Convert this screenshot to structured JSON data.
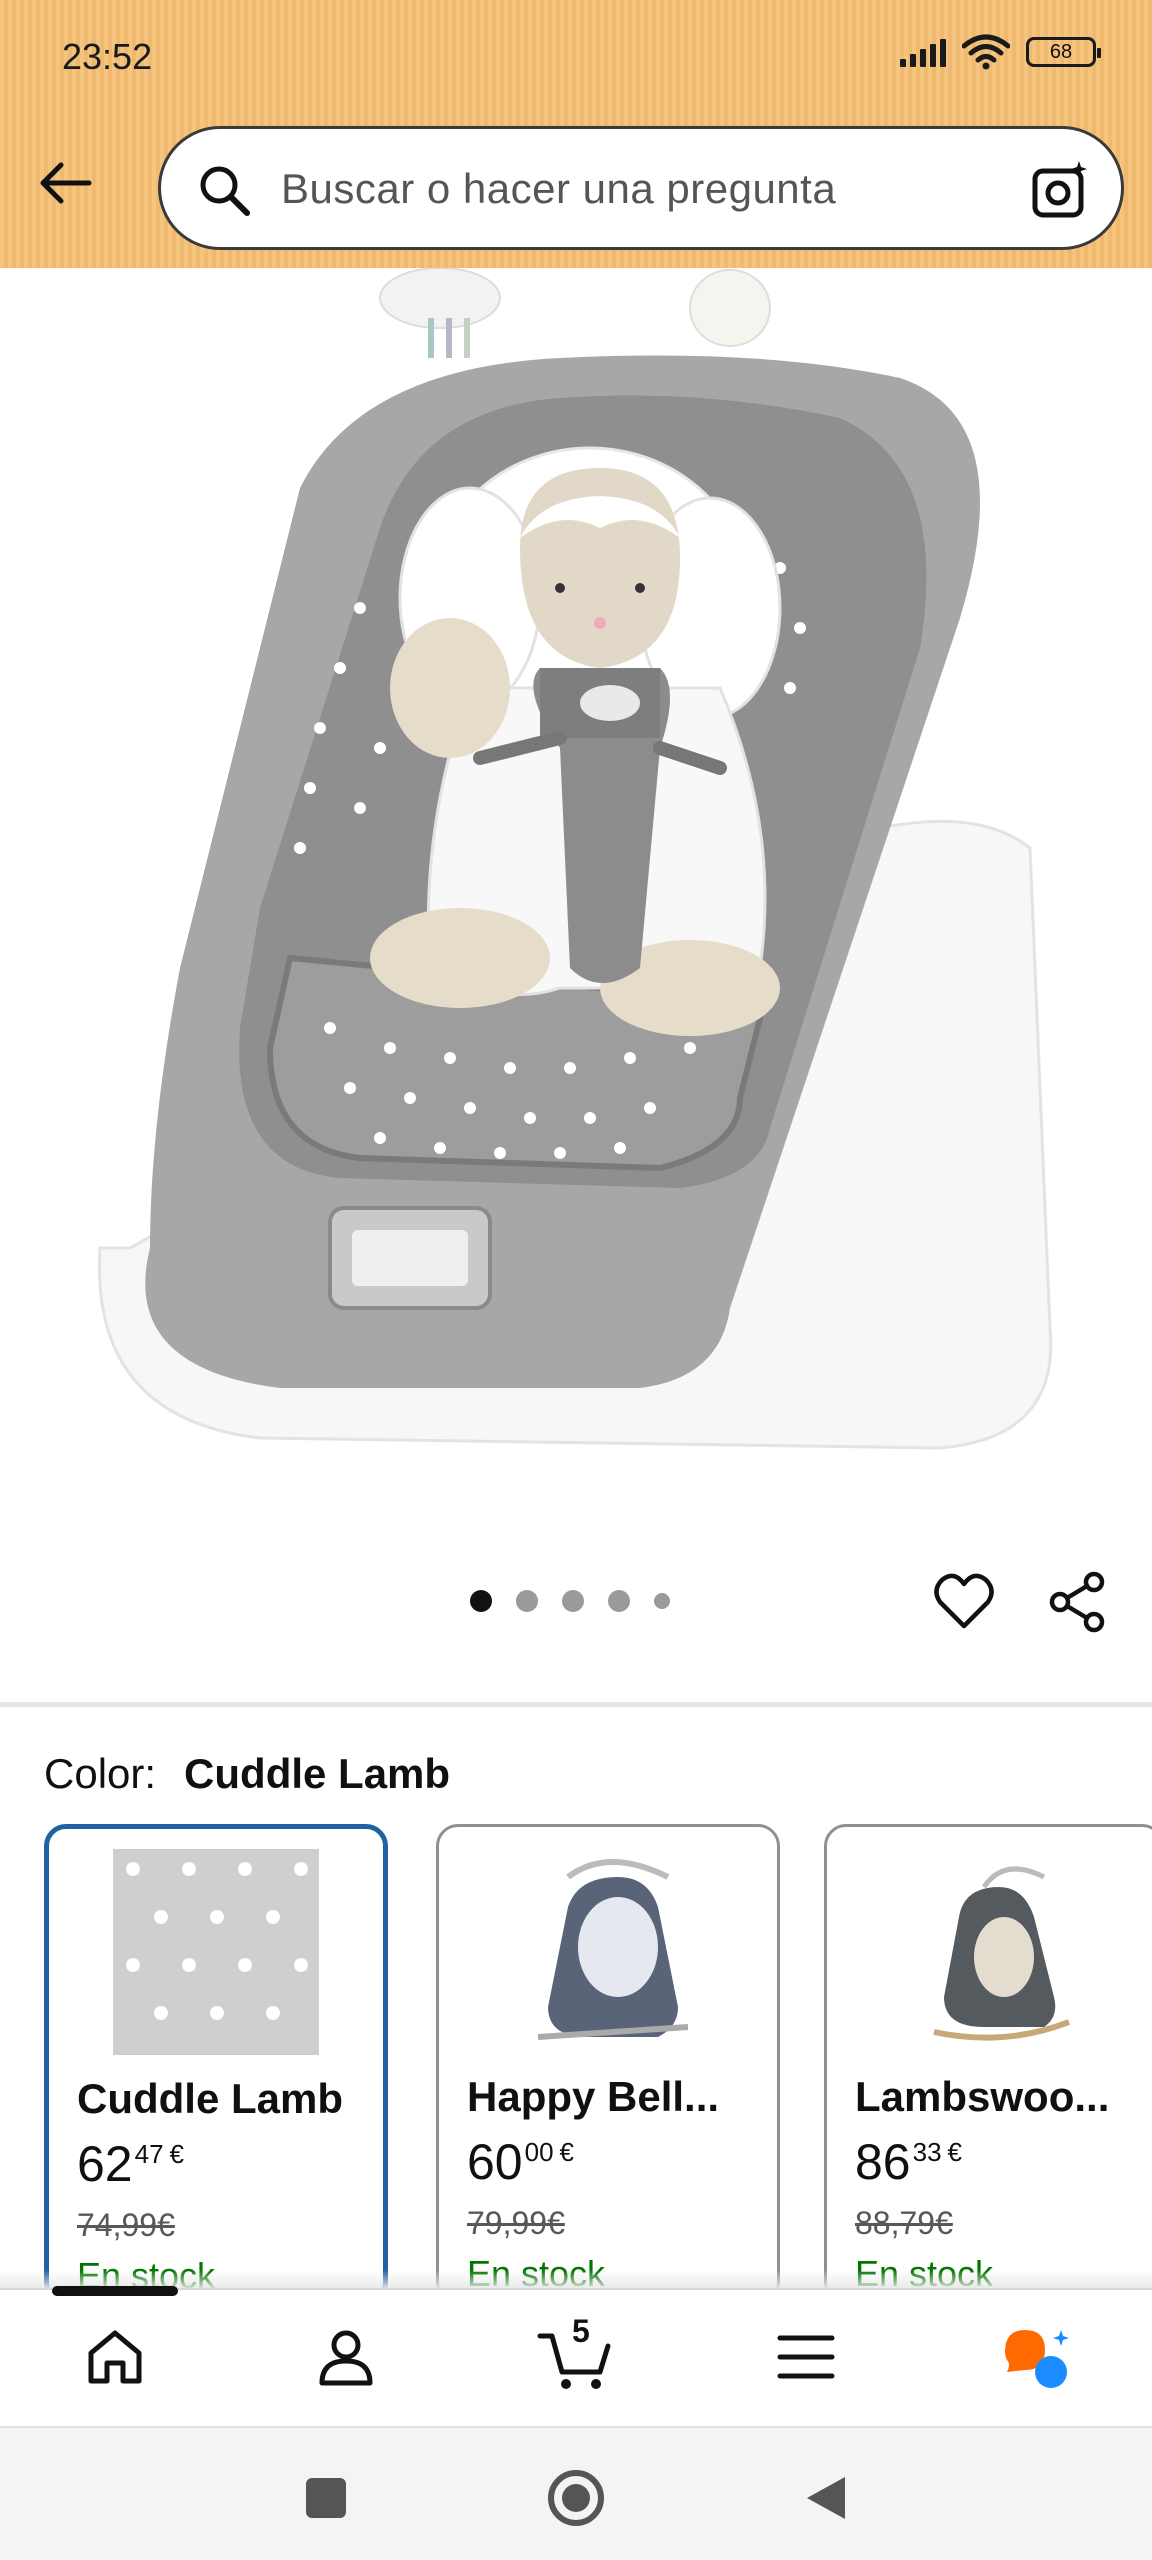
{
  "status_bar": {
    "time": "23:52",
    "battery": "68"
  },
  "search": {
    "placeholder": "Buscar o hacer una pregunta"
  },
  "gallery": {
    "image_count": 5,
    "active_index": 0
  },
  "color": {
    "label": "Color:",
    "selected": "Cuddle Lamb"
  },
  "variants": [
    {
      "name": "Cuddle Lamb",
      "price_whole": "62",
      "price_frac": "47",
      "currency": "€",
      "old_price": "74,99€",
      "stock": "En stock",
      "selected": true
    },
    {
      "name": "Happy Bell...",
      "price_whole": "60",
      "price_frac": "00",
      "currency": "€",
      "old_price": "79,99€",
      "stock": "En stock",
      "selected": false
    },
    {
      "name": "Lambswoo...",
      "price_whole": "86",
      "price_frac": "33",
      "currency": "€",
      "old_price": "88,79€",
      "stock": "En stock",
      "selected": false
    }
  ],
  "bottom_nav": {
    "cart_count": "5"
  },
  "colors": {
    "header": "#f5c47f",
    "selected_border": "#2162a1",
    "stock_green": "#007600"
  }
}
